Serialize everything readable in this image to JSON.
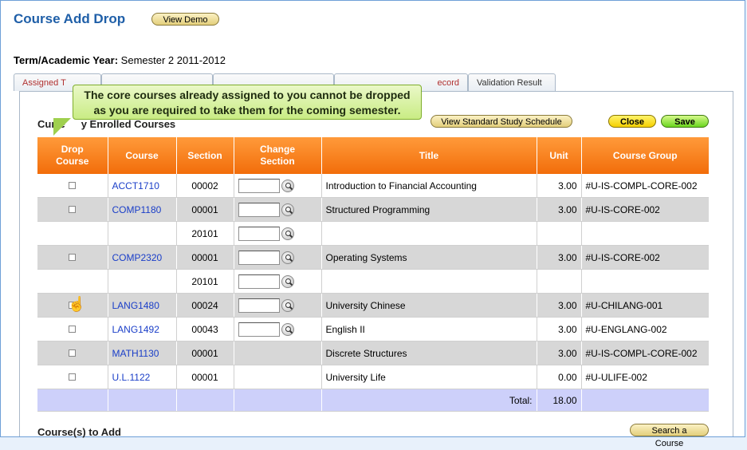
{
  "header": {
    "title": "Course Add Drop",
    "view_demo": "View Demo"
  },
  "term": {
    "label": "Term/Academic Year:",
    "value": "Semester 2 2011-2012"
  },
  "tabs": [
    {
      "label": "Assigned T"
    },
    {
      "label": ""
    },
    {
      "label": ""
    },
    {
      "label": "ecord"
    },
    {
      "label": "Validation Result"
    }
  ],
  "tooltip": {
    "line1": "The core courses already assigned to you cannot be dropped",
    "line2": "as you are required to take them for the coming semester."
  },
  "enrolled": {
    "title_left": "Curre",
    "title_right": "y Enrolled Courses",
    "actions": {
      "view_schedule": "View Standard Study Schedule",
      "close": "Close",
      "save": "Save"
    },
    "columns": [
      "Drop\nCourse",
      "Course",
      "Section",
      "Change\nSection",
      "Title",
      "Unit",
      "Course Group"
    ],
    "rows": [
      {
        "checkbox": true,
        "course": "ACCT1710",
        "section": "00002",
        "change": true,
        "title": "Introduction to Financial Accounting",
        "unit": "3.00",
        "group": "#U-IS-COMPL-CORE-002",
        "alt": false
      },
      {
        "checkbox": true,
        "course": "COMP1180",
        "section": "00001",
        "change": true,
        "title": "Structured Programming",
        "unit": "3.00",
        "group": "#U-IS-CORE-002",
        "alt": true
      },
      {
        "checkbox": false,
        "course": "",
        "section": "20101",
        "change": true,
        "title": "",
        "unit": "",
        "group": "",
        "alt": false
      },
      {
        "checkbox": true,
        "course": "COMP2320",
        "section": "00001",
        "change": true,
        "title": "Operating Systems",
        "unit": "3.00",
        "group": "#U-IS-CORE-002",
        "alt": true
      },
      {
        "checkbox": false,
        "course": "",
        "section": "20101",
        "change": true,
        "title": "",
        "unit": "",
        "group": "",
        "alt": false
      },
      {
        "checkbox": true,
        "course": "LANG1480",
        "section": "00024",
        "change": true,
        "title": "University Chinese",
        "unit": "3.00",
        "group": "#U-CHILANG-001",
        "alt": true
      },
      {
        "checkbox": true,
        "course": "LANG1492",
        "section": "00043",
        "change": true,
        "title": "English II",
        "unit": "3.00",
        "group": "#U-ENGLANG-002",
        "alt": false
      },
      {
        "checkbox": true,
        "course": "MATH1130",
        "section": "00001",
        "change": false,
        "title": "Discrete Structures",
        "unit": "3.00",
        "group": "#U-IS-COMPL-CORE-002",
        "alt": true
      },
      {
        "checkbox": true,
        "course": "U.L.1122",
        "section": "00001",
        "change": false,
        "title": "University Life",
        "unit": "0.00",
        "group": "#U-ULIFE-002",
        "alt": false
      }
    ],
    "total_label": "Total:",
    "total_value": "18.00"
  },
  "add": {
    "title": "Course(s) to Add",
    "search": "Search a Course"
  }
}
